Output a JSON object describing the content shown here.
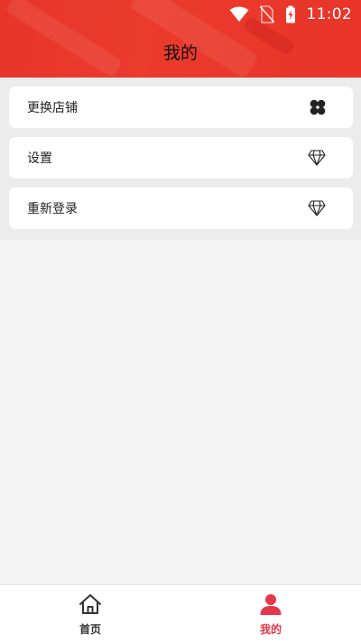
{
  "status_bar": {
    "time": "11:02",
    "icons": [
      "wifi-icon",
      "no-sim-icon",
      "battery-charging-icon"
    ]
  },
  "header": {
    "title": "我的",
    "background": "#e8352a"
  },
  "menu": {
    "items": [
      {
        "label": "更换店铺",
        "icon": "clover-icon"
      },
      {
        "label": "设置",
        "icon": "diamond-icon"
      },
      {
        "label": "重新登录",
        "icon": "diamond-icon"
      }
    ]
  },
  "bottom_nav": {
    "items": [
      {
        "label": "首页",
        "icon": "home-icon",
        "active": false
      },
      {
        "label": "我的",
        "icon": "user-icon",
        "active": true
      }
    ],
    "active_color": "#e7354b",
    "inactive_color": "#333333"
  }
}
